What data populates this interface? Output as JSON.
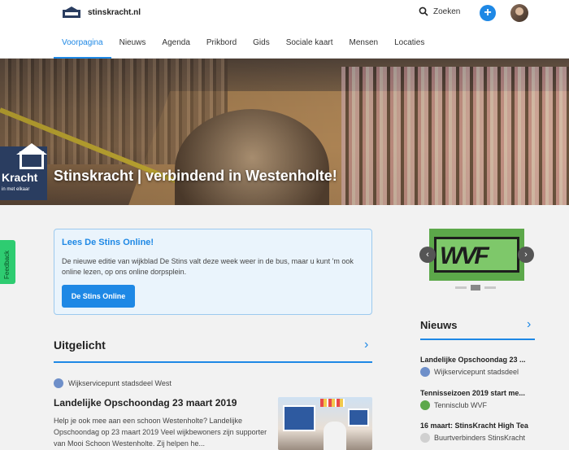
{
  "header": {
    "site_name": "stinskracht.nl",
    "search_label": "Zoeken",
    "plus_label": "+"
  },
  "nav": [
    "Voorpagina",
    "Nieuws",
    "Agenda",
    "Prikbord",
    "Gids",
    "Sociale kaart",
    "Mensen",
    "Locaties"
  ],
  "hero": {
    "title": "Stinskracht | verbindend in Westenholte!",
    "badge_word": "Kracht",
    "badge_sub": "in met elkaar"
  },
  "feedback": "Feedback",
  "promo": {
    "title": "Lees De Stins Online!",
    "text": "De nieuwe editie van wijkblad De Stins valt deze week weer in de bus, maar u kunt 'm ook online lezen, op ons online dorpsplein.",
    "button": "De Stins Online"
  },
  "uitgelicht": {
    "title": "Uitgelicht",
    "org": "Wijkservicepunt stadsdeel West",
    "article_title": "Landelijke Opschoondag 23 maart 2019",
    "article_text": "Help je ook mee aan een schoon Westenholte? Landelijke Opschoondag op 23 maart 2019 Veel wijkbewoners zijn supporter van Mooi Schoon Westenholte. Zij helpen he..."
  },
  "slider": {
    "logo_text": "WVF",
    "prev": "‹",
    "next": "›"
  },
  "nieuws": {
    "title": "Nieuws",
    "items": [
      {
        "title": "Landelijke Opschoondag 23 ...",
        "org": "Wijkservicepunt stadsdeel",
        "org_color": "#6e8fc9"
      },
      {
        "title": "Tennisseizoen 2019 start me...",
        "org": "Tennisclub WVF",
        "org_color": "#5ca84a"
      },
      {
        "title": "16 maart: StinsKracht High Tea",
        "org": "Buurtverbinders StinsKracht",
        "org_color": "#d0d0d0"
      }
    ]
  },
  "colors": {
    "accent": "#1e88e5",
    "feedback": "#2ecc71"
  }
}
